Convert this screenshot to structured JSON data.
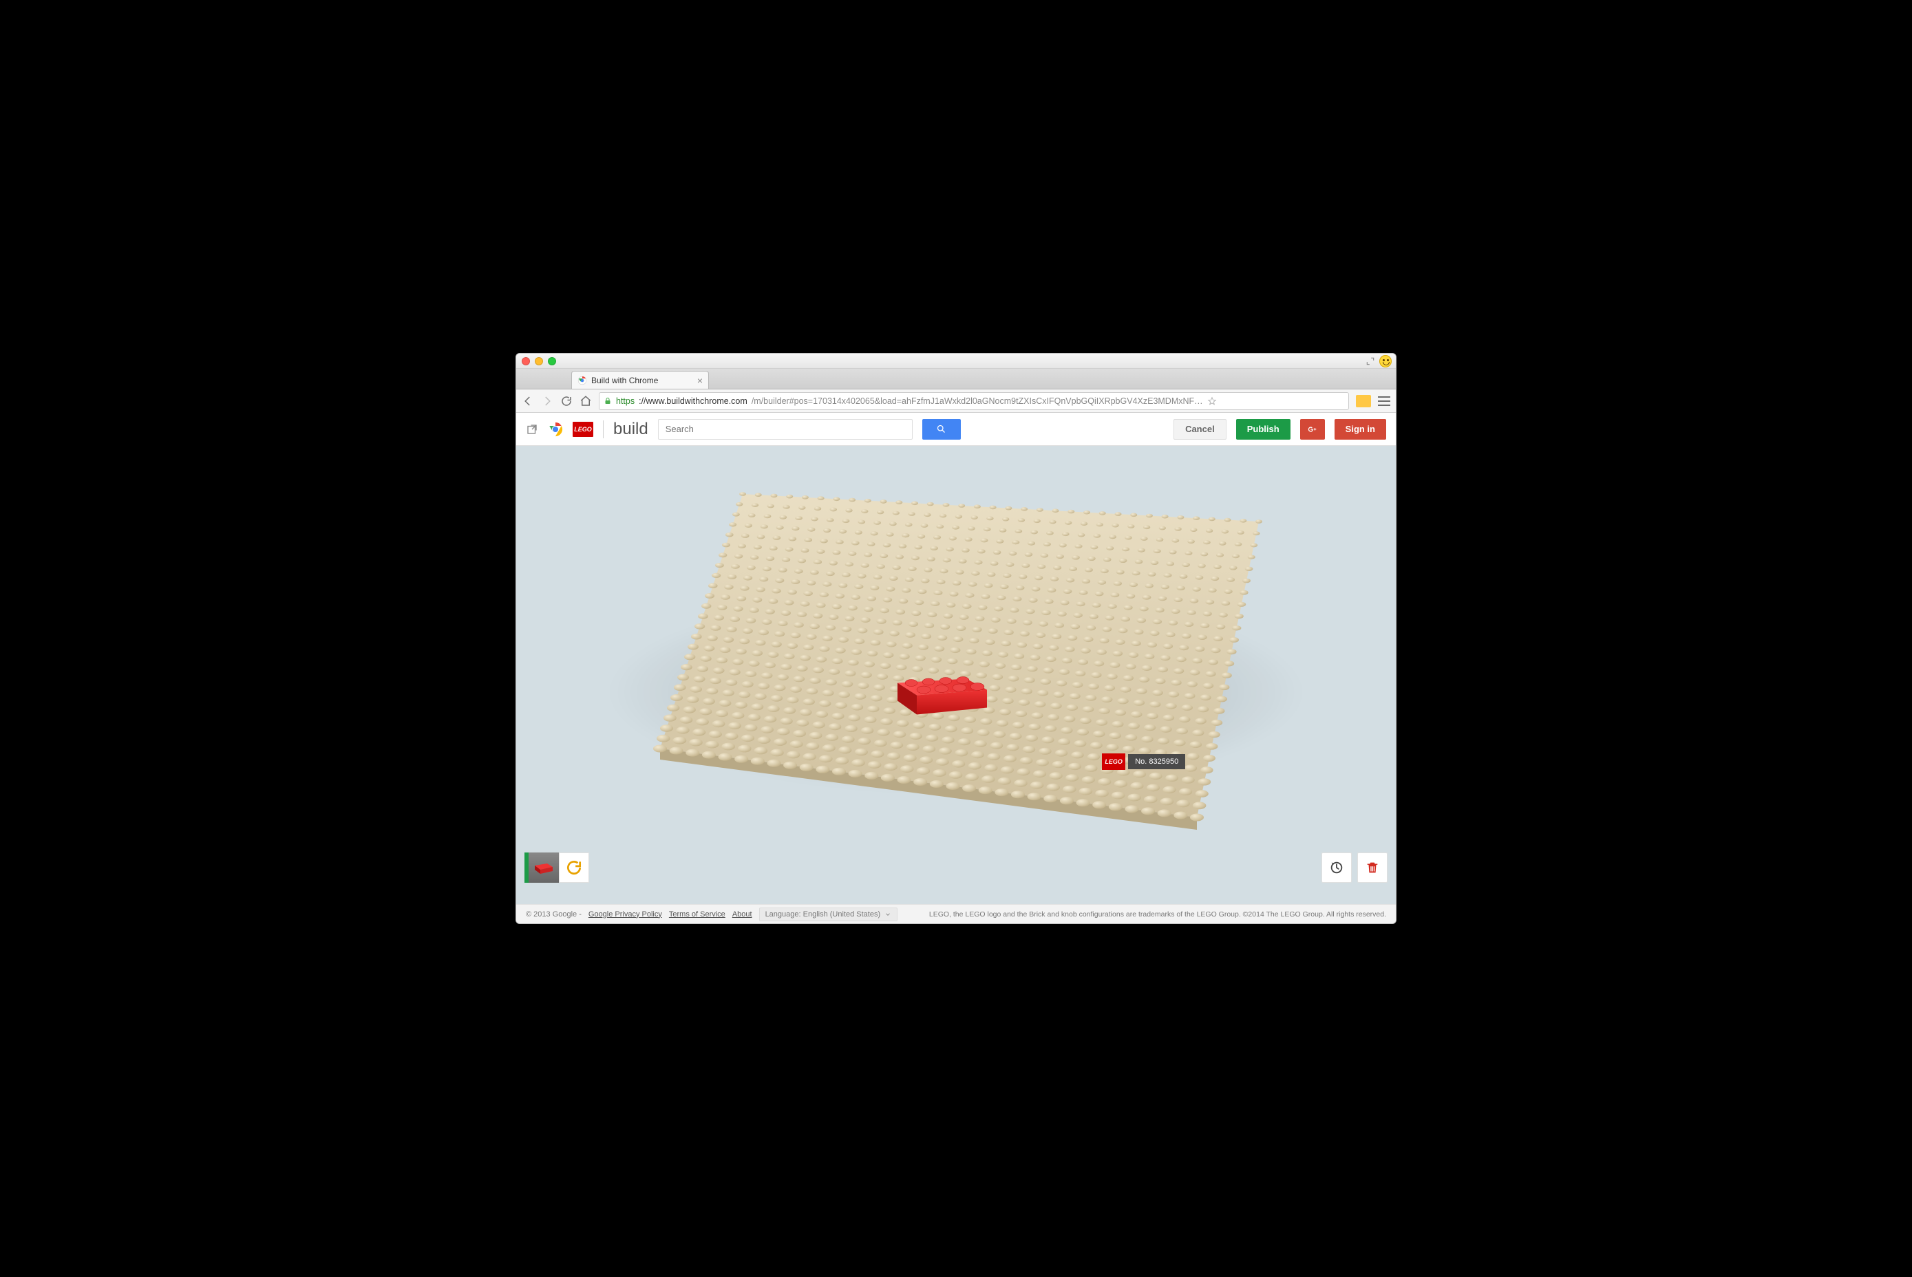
{
  "browser": {
    "tab_title": "Build with Chrome",
    "url_scheme": "https",
    "url_host": "://www.buildwithchrome.com",
    "url_path": "/m/builder#pos=170314x402065&load=ahFzfmJ1aWxkd2l0aGNocm9tZXIsCxIFQnVpbGQiIXRpbGV4XzE3MDMxNF…"
  },
  "header": {
    "lego_text": "LEGO",
    "build_label": "build",
    "search_placeholder": "Search",
    "cancel": "Cancel",
    "publish": "Publish",
    "signin": "Sign in"
  },
  "build": {
    "number_prefix": "No. ",
    "number": "8325950",
    "lego_text": "LEGO"
  },
  "footer": {
    "copyright": "© 2013 Google  -  ",
    "privacy": "Google Privacy Policy",
    "tos": "Terms of Service",
    "about": "About",
    "lang_label": "Language: English (United States)",
    "legal": "LEGO, the LEGO logo and the Brick and knob configurations are trademarks of the LEGO Group. ©2014 The LEGO Group. All rights reserved."
  },
  "colors": {
    "brick_red": "#d22a1f",
    "plate_tan": "#ded0b2",
    "publish_green": "#1c9b47",
    "signin_red": "#d34836"
  }
}
